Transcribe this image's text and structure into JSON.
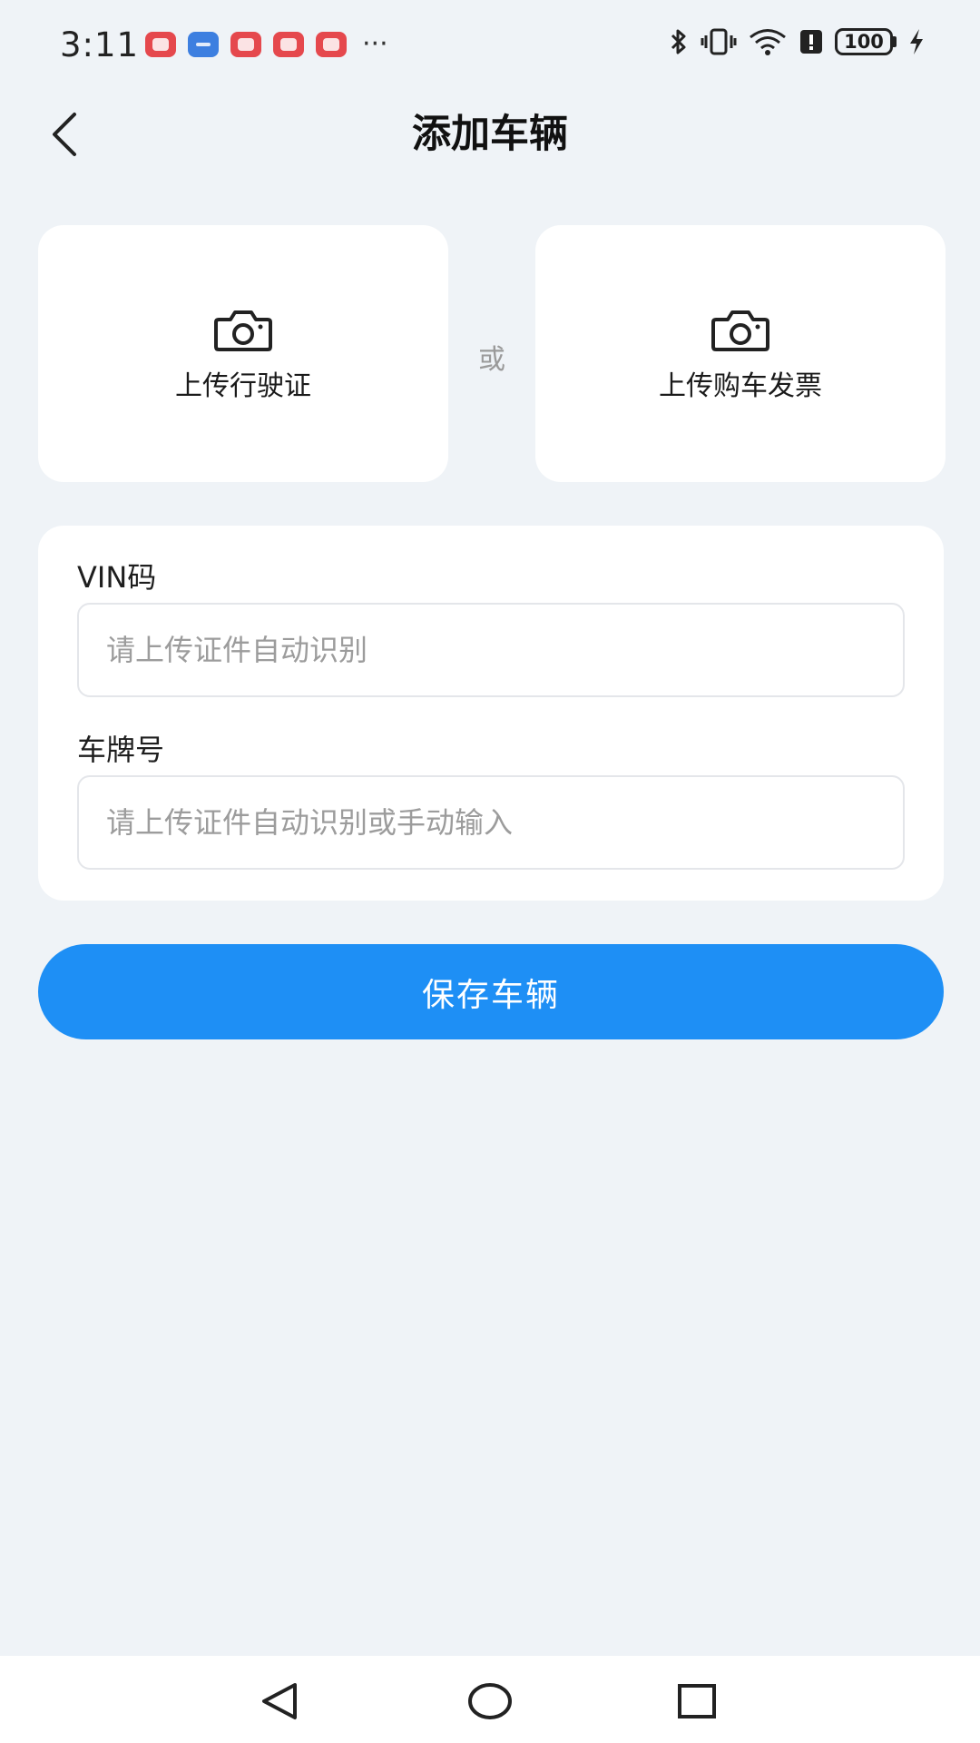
{
  "status_bar": {
    "time": "3:11",
    "more": "···",
    "battery": "100"
  },
  "header": {
    "title": "添加车辆"
  },
  "upload": {
    "license_label": "上传行驶证",
    "or_label": "或",
    "invoice_label": "上传购车发票"
  },
  "form": {
    "vin_label": "VIN码",
    "vin_placeholder": "请上传证件自动识别",
    "plate_label": "车牌号",
    "plate_placeholder": "请上传证件自动识别或手动输入"
  },
  "actions": {
    "save_label": "保存车辆"
  },
  "colors": {
    "primary": "#1e8ff5",
    "background": "#eff3f7"
  }
}
